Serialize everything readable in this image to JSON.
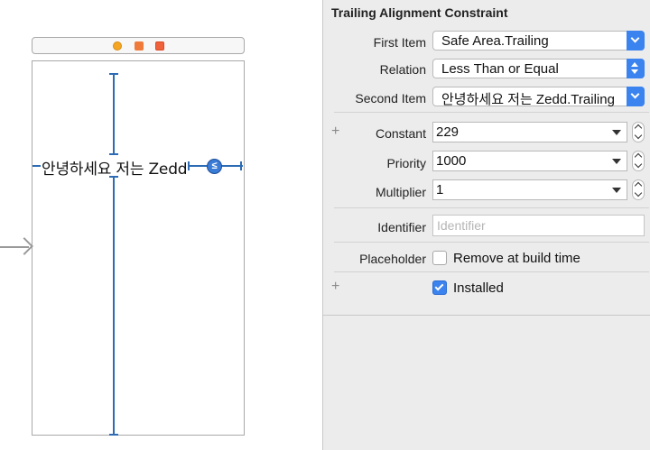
{
  "canvas": {
    "label_text": "안녕하세요 저는 Zedd",
    "constraint_badge": "≤"
  },
  "inspector": {
    "title": "Trailing Alignment Constraint",
    "first_item": {
      "label": "First Item",
      "value": "Safe Area.Trailing"
    },
    "relation": {
      "label": "Relation",
      "value": "Less Than or Equal"
    },
    "second_item": {
      "label": "Second Item",
      "value": "안녕하세요 저는 Zedd.Trailing"
    },
    "constant": {
      "label": "Constant",
      "value": "229"
    },
    "priority": {
      "label": "Priority",
      "value": "1000"
    },
    "multiplier": {
      "label": "Multiplier",
      "value": "1"
    },
    "identifier": {
      "label": "Identifier",
      "value": "",
      "placeholder": "Identifier"
    },
    "placeholder_row": {
      "label": "Placeholder",
      "checkbox_label": "Remove at build time",
      "checked": false
    },
    "installed": {
      "checkbox_label": "Installed",
      "checked": true
    },
    "add_symbol": "+"
  },
  "colors": {
    "constraint_blue": "#2d6cb5",
    "accent_blue": "#3b83ee",
    "panel_bg": "#ececec"
  }
}
